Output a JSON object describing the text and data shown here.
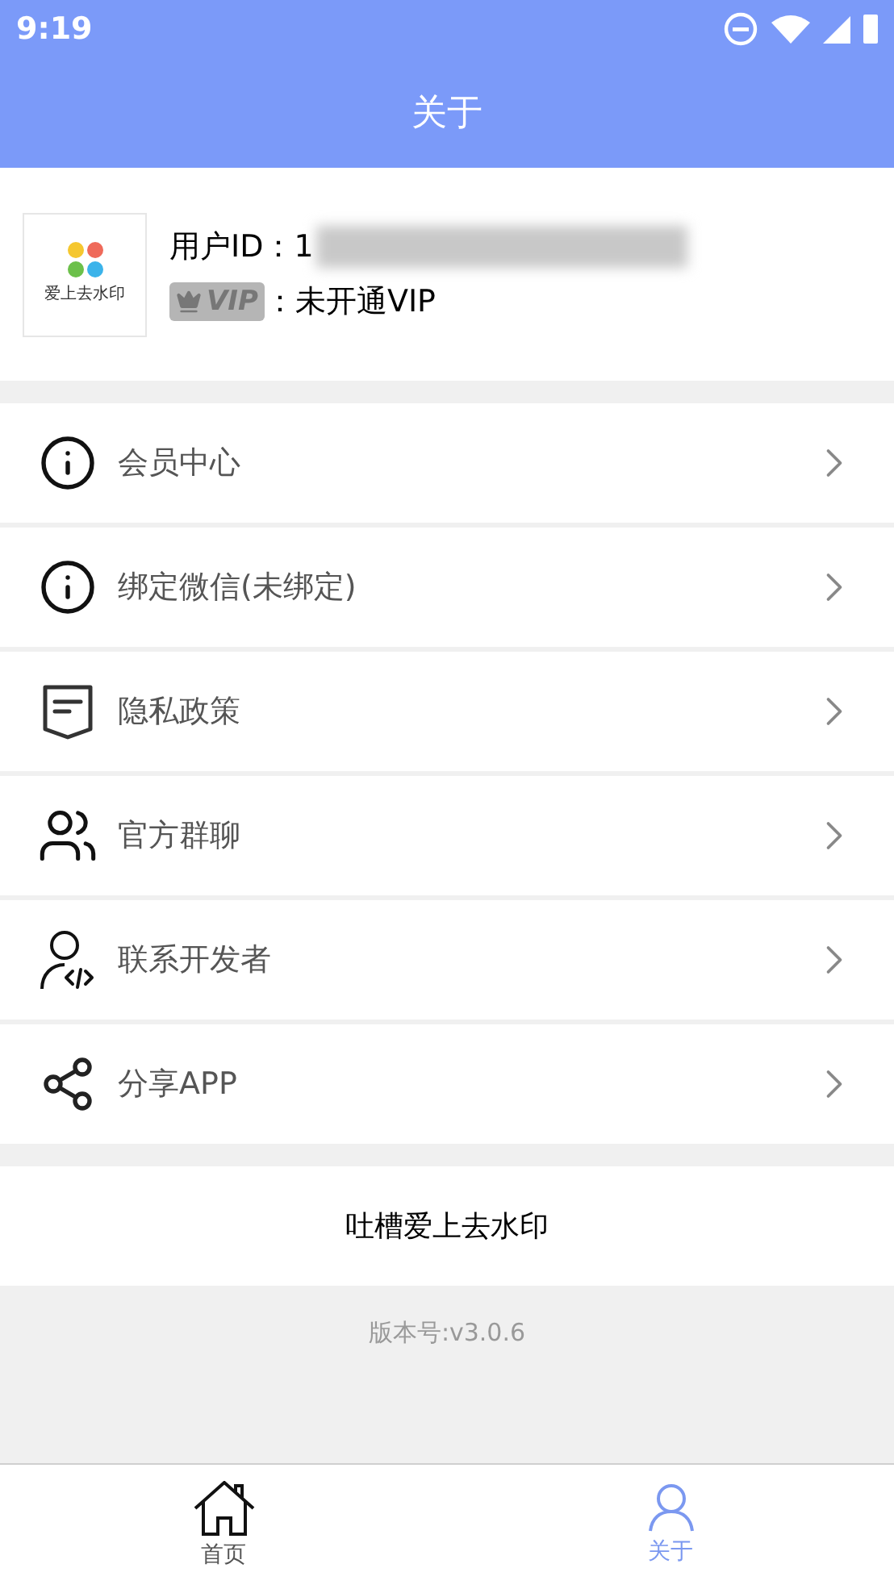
{
  "status_bar": {
    "time": "9:19"
  },
  "header": {
    "title": "关于"
  },
  "profile": {
    "logo_text": "爱上去水印",
    "user_id_label": "用户ID：",
    "user_id_visible": "1",
    "vip_badge": "VIP",
    "vip_status": "：未开通VIP"
  },
  "menu": [
    {
      "kind": "info",
      "label": "会员中心"
    },
    {
      "kind": "info",
      "label": "绑定微信(未绑定)"
    },
    {
      "kind": "policy",
      "label": "隐私政策"
    },
    {
      "kind": "group",
      "label": "官方群聊"
    },
    {
      "kind": "developer",
      "label": "联系开发者"
    },
    {
      "kind": "share",
      "label": "分享APP"
    }
  ],
  "feedback_button": "吐槽爱上去水印",
  "version": "版本号:v3.0.6",
  "bottom_nav": [
    {
      "kind": "home",
      "label": "首页",
      "selected": false
    },
    {
      "kind": "user",
      "label": "关于",
      "selected": true
    }
  ]
}
